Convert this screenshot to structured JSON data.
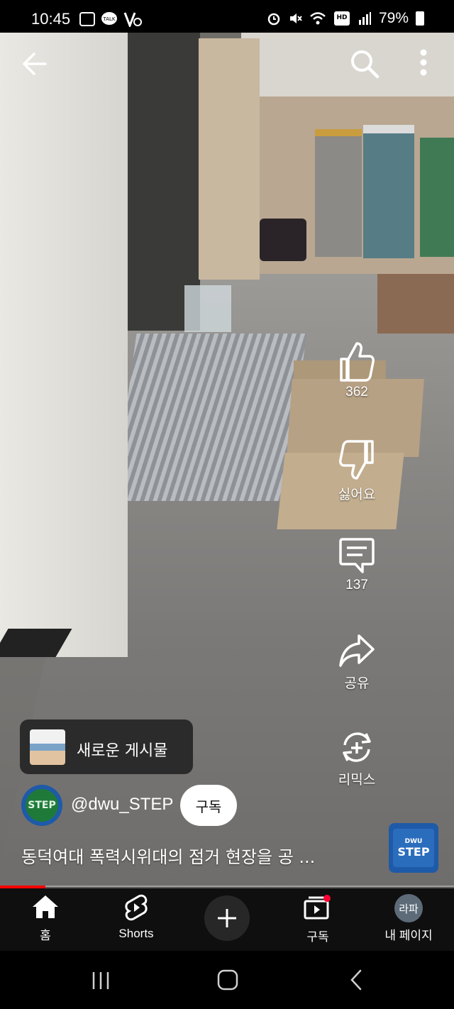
{
  "status_bar": {
    "time": "10:45",
    "battery": "79%",
    "icons": [
      "gallery-icon",
      "talk-icon",
      "v-icon",
      "alarm-icon",
      "mute-icon",
      "wifi-icon",
      "hd-voice-icon",
      "signal-icon",
      "battery-icon"
    ]
  },
  "top_bar": {
    "back_icon": "arrow-left-icon",
    "search_icon": "search-icon",
    "more_icon": "more-vert-icon"
  },
  "actions": {
    "like_count": "362",
    "dislike_label": "싫어요",
    "comment_count": "137",
    "share_label": "공유",
    "remix_label": "리믹스"
  },
  "new_post": {
    "label": "새로운 게시물"
  },
  "channel": {
    "handle": "@dwu_STEP",
    "avatar_text": "STEP",
    "subscribe_label": "구독"
  },
  "video": {
    "title": "동덕여대 폭력시위대의 점거 현장을 공 ...",
    "progress": 0.1,
    "sound_thumb_text_top": "DWU",
    "sound_thumb_text": "STEP"
  },
  "bottom_nav": {
    "home": "홈",
    "shorts": "Shorts",
    "subscriptions": "구독",
    "profile": "내 페이지",
    "profile_avatar": "라파"
  },
  "colors": {
    "accent": "#ff0000",
    "nav_bg": "#0f0f0f",
    "create_bg": "#272727"
  }
}
